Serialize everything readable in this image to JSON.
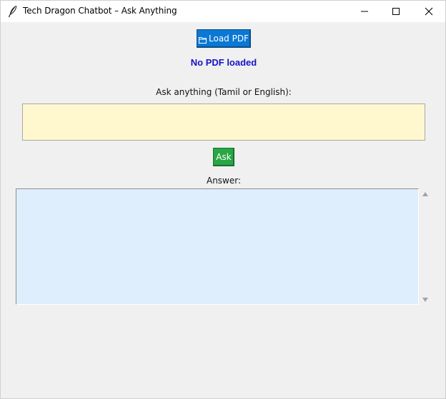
{
  "window": {
    "title": "Tech Dragon Chatbot – Ask Anything",
    "icon": "feather-icon"
  },
  "toolbar": {
    "load_pdf_label": "Load PDF",
    "load_pdf_icon": "folder-icon",
    "load_pdf_color": "#0a78d4"
  },
  "status": {
    "text": "No PDF loaded",
    "color": "#1414c8"
  },
  "question": {
    "label": "Ask anything (Tamil or English):",
    "value": "",
    "background": "#fff8cf"
  },
  "ask": {
    "label": "Ask",
    "color": "#29a745"
  },
  "answer": {
    "label": "Answer:",
    "value": "",
    "background": "#deeefc"
  }
}
